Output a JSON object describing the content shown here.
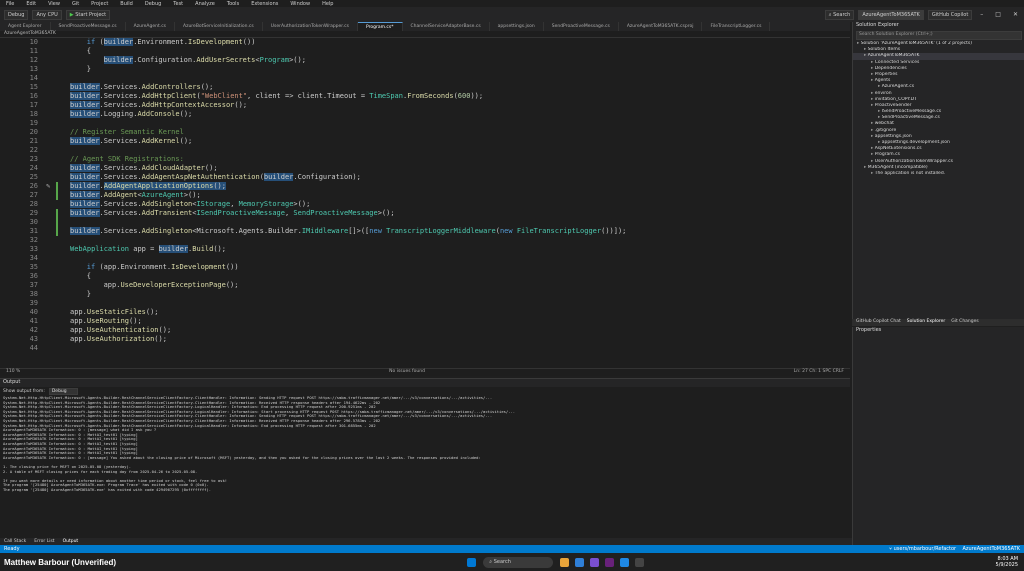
{
  "menu": [
    "File",
    "Edit",
    "View",
    "Git",
    "Project",
    "Build",
    "Debug",
    "Test",
    "Analyze",
    "Tools",
    "Extensions",
    "Window",
    "Help"
  ],
  "search_label": "Search",
  "window_title": "AzureAgentToM365ATK",
  "toolbar": {
    "config": "Debug",
    "platform": "Any CPU",
    "start": "Start Project",
    "copilot": "GitHub Copilot"
  },
  "tabs": [
    "Agent Explorer",
    "SendProactiveMessage.cs",
    "AzureAgent.cs",
    "AzureBotServiceInitialization.cs",
    "UserAuthorizationTokenWrapper.cs",
    "Program.cs*",
    "ChannelServiceAdapterBase.cs",
    "appsettings.json",
    "SendProactiveMessage.cs",
    "AzureAgentToM365ATK.csproj",
    "FileTranscriptLogger.cs"
  ],
  "active_tab_index": 5,
  "subtab_path": "AzureAgentToM365ATK",
  "code_lines": [
    {
      "n": "10",
      "html": "<span class=\"kw\">if</span> (<span class=\"hl\">builder</span>.Environment.<span class=\"fn\">IsDevelopment</span>())",
      "indent": 4
    },
    {
      "n": "11",
      "html": "{",
      "indent": 4
    },
    {
      "n": "12",
      "html": "<span class=\"hl\">builder</span>.Configuration.<span class=\"fn\">AddUserSecrets</span>&lt;<span class=\"ty\">Program</span>&gt;();",
      "indent": 8
    },
    {
      "n": "13",
      "html": "}",
      "indent": 4
    },
    {
      "n": "14",
      "html": "",
      "indent": 0
    },
    {
      "n": "15",
      "html": "<span class=\"hl\">builder</span>.Services.<span class=\"fn\">AddControllers</span>();",
      "indent": 0
    },
    {
      "n": "16",
      "html": "<span class=\"hl\">builder</span>.Services.<span class=\"fn\">AddHttpClient</span>(<span class=\"st\">\"WebClient\"</span>, client =&gt; client.Timeout = <span class=\"ty\">TimeSpan</span>.<span class=\"fn\">FromSeconds</span>(<span class=\"nm\">600</span>));",
      "indent": 0
    },
    {
      "n": "17",
      "html": "<span class=\"hl\">builder</span>.Services.<span class=\"fn\">AddHttpContextAccessor</span>();",
      "indent": 0
    },
    {
      "n": "18",
      "html": "<span class=\"hl\">builder</span>.Logging.<span class=\"fn\">AddConsole</span>();",
      "indent": 0
    },
    {
      "n": "19",
      "html": "",
      "indent": 0
    },
    {
      "n": "20",
      "html": "<span class=\"cm\">// Register Semantic Kernel</span>",
      "indent": 0
    },
    {
      "n": "21",
      "html": "<span class=\"hl\">builder</span>.Services.<span class=\"fn\">AddKernel</span>();",
      "indent": 0
    },
    {
      "n": "22",
      "html": "",
      "indent": 0
    },
    {
      "n": "23",
      "html": "<span class=\"cm\">// Agent SDK Registrations:</span>",
      "indent": 0
    },
    {
      "n": "24",
      "html": "<span class=\"hl\">builder</span>.Services.<span class=\"fn\">AddCloudAdapter</span>();",
      "indent": 0
    },
    {
      "n": "25",
      "html": "<span class=\"hl\">builder</span>.Services.<span class=\"fn\">AddAgentAspNetAuthentication</span>(<span class=\"hl\">builder</span>.Configuration);",
      "indent": 0
    },
    {
      "n": "26",
      "html": "<span class=\"hl\">builder</span>.<span class=\"fn hl\">AddAgentApplicationOptions</span><span class=\"hl\">();</span>",
      "indent": 0
    },
    {
      "n": "27",
      "html": "<span class=\"hl\">builder</span>.<span class=\"fn\">AddAgent</span>&lt;<span class=\"ty\">AzureAgent</span>&gt;();",
      "indent": 0
    },
    {
      "n": "28",
      "html": "<span class=\"hl\">builder</span>.Services.<span class=\"fn\">AddSingleton</span>&lt;<span class=\"ty\">IStorage</span>, <span class=\"ty\">MemoryStorage</span>&gt;();",
      "indent": 0
    },
    {
      "n": "29",
      "html": "<span class=\"hl\">builder</span>.Services.<span class=\"fn\">AddTransient</span>&lt;<span class=\"ty\">ISendProactiveMessage</span>, <span class=\"ty\">SendProactiveMessage</span>&gt;();",
      "indent": 0
    },
    {
      "n": "30",
      "html": "",
      "indent": 0
    },
    {
      "n": "31",
      "html": "<span class=\"hl\">builder</span>.Services.<span class=\"fn\">AddSingleton</span>&lt;Microsoft.Agents.Builder.<span class=\"ty\">IMiddleware</span>[]&gt;([<span class=\"kw\">new</span> <span class=\"ty\">TranscriptLoggerMiddleware</span>(<span class=\"kw\">new</span> <span class=\"ty\">FileTranscriptLogger</span>())]);",
      "indent": 0
    },
    {
      "n": "32",
      "html": "",
      "indent": 0
    },
    {
      "n": "33",
      "html": "<span class=\"ty\">WebApplication</span> app = <span class=\"hl\">builder</span>.<span class=\"fn\">Build</span>();",
      "indent": 0
    },
    {
      "n": "34",
      "html": "",
      "indent": 0
    },
    {
      "n": "35",
      "html": "<span class=\"kw\">if</span> (app.Environment.<span class=\"fn\">IsDevelopment</span>())",
      "indent": 4
    },
    {
      "n": "36",
      "html": "{",
      "indent": 4
    },
    {
      "n": "37",
      "html": "app.<span class=\"fn\">UseDeveloperExceptionPage</span>();",
      "indent": 8
    },
    {
      "n": "38",
      "html": "}",
      "indent": 4
    },
    {
      "n": "39",
      "html": "",
      "indent": 0
    },
    {
      "n": "40",
      "html": "app.<span class=\"fn\">UseStaticFiles</span>();",
      "indent": 0
    },
    {
      "n": "41",
      "html": "app.<span class=\"fn\">UseRouting</span>();",
      "indent": 0
    },
    {
      "n": "42",
      "html": "app.<span class=\"fn\">UseAuthentication</span>();",
      "indent": 0
    },
    {
      "n": "43",
      "html": "app.<span class=\"fn\">UseAuthorization</span>();",
      "indent": 0
    },
    {
      "n": "44",
      "html": "",
      "indent": 0
    }
  ],
  "editor_status": {
    "zoom": "110 %",
    "issues": "No issues found",
    "position": "Ln: 27   Ch: 1   SPC   CRLF"
  },
  "output": {
    "title": "Output",
    "show_label": "Show output from:",
    "source": "Debug",
    "lines": [
      "System.Net.Http.HttpClient.Microsoft.Agents.Builder.RestChannelServiceClientFactory.ClientHandler: Information: Sending HTTP request POST https://smba.trafficmanager.net/amer/.../v3/conversations/.../activities/...",
      "System.Net.Http.HttpClient.Microsoft.Agents.Builder.RestChannelServiceClientFactory.ClientHandler: Information: Received HTTP response headers after 194.4622ms - 202",
      "System.Net.Http.HttpClient.Microsoft.Agents.Builder.RestChannelServiceClientFactory.LogicalHandler: Information: End processing HTTP request after 200.9251ms - 202",
      "System.Net.Http.HttpClient.Microsoft.Agents.Builder.RestChannelServiceClientFactory.LogicalHandler: Information: Start processing HTTP request POST https://smba.trafficmanager.net/amer/.../v3/conversations/.../activities/...",
      "System.Net.Http.HttpClient.Microsoft.Agents.Builder.RestChannelServiceClientFactory.ClientHandler: Information: Sending HTTP request POST https://smba.trafficmanager.net/amer/.../v3/conversations/.../activities/...",
      "System.Net.Http.HttpClient.Microsoft.Agents.Builder.RestChannelServiceClientFactory.ClientHandler: Information: Received HTTP response headers after 296.5783ms - 202",
      "System.Net.Http.HttpClient.Microsoft.Agents.Builder.RestChannelServiceClientFactory.LogicalHandler: Information: End processing HTTP request after 301.6855ms - 202",
      "AzureAgentToM365ATK Information: 0 : [message] what did I ask you ?",
      "AzureAgentToM365ATK Information: 0 : MattAI_test01 [typing]",
      "AzureAgentToM365ATK Information: 0 : MattAI_test01 [typing]",
      "AzureAgentToM365ATK Information: 0 : MattAI_test01 [typing]",
      "AzureAgentToM365ATK Information: 0 : MattAI_test01 [typing]",
      "AzureAgentToM365ATK Information: 0 : MattAI_test01 [typing]",
      "AzureAgentToM365ATK Information: 0 : [message] You asked about the closing price of Microsoft (MSFT) yesterday, and then you asked for the closing prices over the last 2 weeks. The responses provided included:",
      "",
      "1. The closing price for MSFT on 2025-05-08 (yesterday).",
      "2. A table of MSFT closing prices for each trading day from 2025-04-26 to 2025-05-08.",
      "",
      "If you want more details or need information about another time period or stock, feel free to ask!",
      "The program '[25480] AzureAgentToM365ATK.exe: Program Trace' has exited with code 0 (0x0).",
      "The program '[25480] AzureAgentToM365ATK.exe' has exited with code 4294967295 (0xffffffff)."
    ]
  },
  "bottom_tabs": [
    "Call Stack",
    "Error List",
    "Output"
  ],
  "statusbar": {
    "left": "Ready",
    "branch": "users/mbarbour/Refactor",
    "repo": "AzureAgentToM365ATK"
  },
  "solution_explorer": {
    "title": "Solution Explorer",
    "search_placeholder": "Search Solution Explorer (Ctrl+;)",
    "items": [
      {
        "text": "Solution 'AzureAgentToM365ATK' (1 of 2 projects)",
        "depth": 0
      },
      {
        "text": "Solution Items",
        "depth": 1
      },
      {
        "text": "AzureAgentToM365ATK",
        "depth": 1,
        "sel": true
      },
      {
        "text": "Connected Services",
        "depth": 2
      },
      {
        "text": "Dependencies",
        "depth": 2
      },
      {
        "text": "Properties",
        "depth": 2
      },
      {
        "text": "Agents",
        "depth": 2
      },
      {
        "text": "AzureAgent.cs",
        "depth": 3
      },
      {
        "text": "environ",
        "depth": 2
      },
      {
        "text": "invitation_COPY.DT",
        "depth": 2
      },
      {
        "text": "ProactiveSender",
        "depth": 2
      },
      {
        "text": "ISendProactiveMessage.cs",
        "depth": 3
      },
      {
        "text": "SendProactiveMessage.cs",
        "depth": 3
      },
      {
        "text": "webchat",
        "depth": 2
      },
      {
        "text": ".gitignore",
        "depth": 2
      },
      {
        "text": "appsettings.json",
        "depth": 2
      },
      {
        "text": "appsettings.development.json",
        "depth": 3
      },
      {
        "text": "AspNetExtensions.cs",
        "depth": 2
      },
      {
        "text": "Program.cs",
        "depth": 2
      },
      {
        "text": "UserAuthorizationTokenWrapper.cs",
        "depth": 2
      },
      {
        "text": "M365Agent (incompatible)",
        "depth": 1
      },
      {
        "text": "The application is not installed.",
        "depth": 2
      }
    ],
    "tabs": [
      "GitHub Copilot Chat",
      "Solution Explorer",
      "Git Changes"
    ]
  },
  "properties_title": "Properties",
  "taskbar": {
    "user": "Matthew Barbour (Unverified)",
    "search": "Search",
    "time": "8:03 AM",
    "date": "5/9/2025"
  }
}
